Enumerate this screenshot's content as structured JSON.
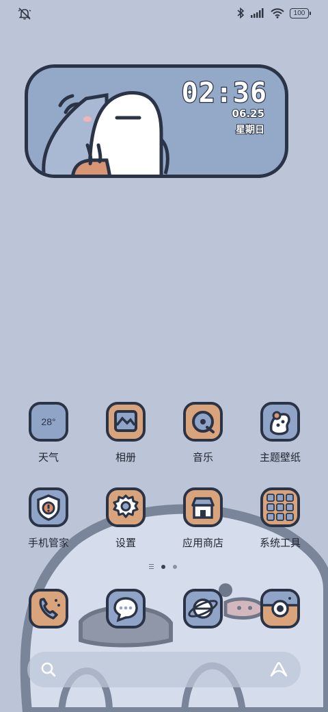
{
  "status_bar": {
    "left_icon": "muted-bell-icon",
    "right_icons": [
      "bluetooth-icon",
      "cellular-signal-icon",
      "wifi-icon"
    ],
    "battery": "100"
  },
  "clock_widget": {
    "time": "02:36",
    "date": "06.25",
    "weekday": "星期日"
  },
  "apps": [
    {
      "label": "天气",
      "icon": "weather-icon",
      "value": "28°"
    },
    {
      "label": "相册",
      "icon": "gallery-icon"
    },
    {
      "label": "音乐",
      "icon": "music-icon"
    },
    {
      "label": "主题壁纸",
      "icon": "theme-icon"
    },
    {
      "label": "手机管家",
      "icon": "security-icon"
    },
    {
      "label": "设置",
      "icon": "gear-icon"
    },
    {
      "label": "应用商店",
      "icon": "store-icon"
    },
    {
      "label": "系统工具",
      "icon": "tools-folder-icon"
    }
  ],
  "dock": [
    {
      "icon": "phone-icon"
    },
    {
      "icon": "messages-icon"
    },
    {
      "icon": "browser-icon"
    },
    {
      "icon": "camera-icon"
    }
  ],
  "page_indicator": {
    "pages": 2,
    "active": 1
  },
  "search_bar": {
    "left_icon": "search-icon",
    "right_icon": "assistant-icon"
  }
}
